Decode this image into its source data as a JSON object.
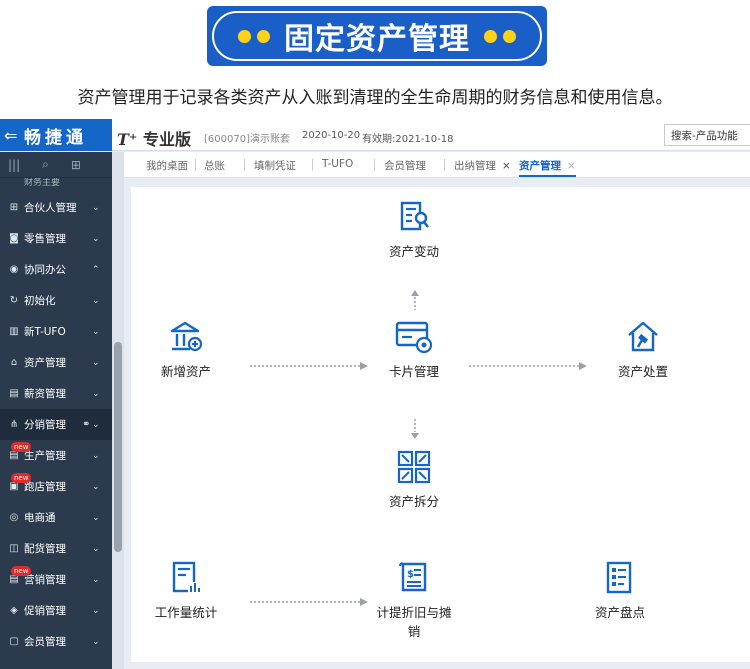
{
  "banner": {
    "title": "固定资产管理"
  },
  "subtitle": "资产管理用于记录各类资产从入账到清理的全生命周期的财务信息和使用信息。",
  "app": {
    "brand": "畅捷通",
    "product_mark": "T⁺",
    "product_name": "专业版",
    "account": "[600070]演示账套",
    "date": "2020-10-20",
    "valid": "有效期:2021-10-18",
    "search_placeholder": "搜索-产品功能"
  },
  "sidebar": {
    "partial_item": "财务主要",
    "items": [
      {
        "label": "合伙人管理",
        "icon": "partner-icon",
        "chevron": "⌄",
        "new": ""
      },
      {
        "label": "零售管理",
        "icon": "camera-icon",
        "chevron": "⌄",
        "new": ""
      },
      {
        "label": "协同办公",
        "icon": "collab-icon",
        "chevron": "⌃",
        "new": ""
      },
      {
        "label": "初始化",
        "icon": "init-icon",
        "chevron": "⌄",
        "new": ""
      },
      {
        "label": "新T-UFO",
        "icon": "ufo-icon",
        "chevron": "⌄",
        "new": ""
      },
      {
        "label": "资产管理",
        "icon": "bank-icon",
        "chevron": "⌄",
        "new": ""
      },
      {
        "label": "薪资管理",
        "icon": "salary-icon",
        "chevron": "⌄",
        "new": ""
      },
      {
        "label": "分销管理",
        "icon": "distribution-icon",
        "chevron": "⌄",
        "new": ""
      },
      {
        "label": "生产管理",
        "icon": "production-icon",
        "chevron": "⌄",
        "new": "new"
      },
      {
        "label": "跑店管理",
        "icon": "store-icon",
        "chevron": "⌄",
        "new": "new"
      },
      {
        "label": "电商通",
        "icon": "ecommerce-icon",
        "chevron": "⌄",
        "new": ""
      },
      {
        "label": "配货管理",
        "icon": "allocation-icon",
        "chevron": "⌄",
        "new": ""
      },
      {
        "label": "营销管理",
        "icon": "marketing-icon",
        "chevron": "⌄",
        "new": "new"
      },
      {
        "label": "促销管理",
        "icon": "promotion-icon",
        "chevron": "⌄",
        "new": ""
      },
      {
        "label": "会员管理",
        "icon": "member-icon",
        "chevron": "⌄",
        "new": ""
      }
    ]
  },
  "tabs": [
    {
      "label": "我的桌面"
    },
    {
      "label": "总账"
    },
    {
      "label": "填制凭证"
    },
    {
      "label": "T-UFO"
    },
    {
      "label": "会员管理"
    },
    {
      "label": "出纳管理",
      "close": "×"
    },
    {
      "label": "资产管理",
      "close": "×",
      "active": true
    }
  ],
  "flow": {
    "change": "资产变动",
    "add": "新增资产",
    "card": "卡片管理",
    "dispose": "资产处置",
    "split": "资产拆分",
    "workload": "工作量统计",
    "depreciation": "计提折旧与摊销",
    "inventory": "资产盘点"
  },
  "colors": {
    "accent": "#1466c9",
    "banner": "#1a5fc8",
    "sidebar": "#2b3a4c",
    "dot": "#ffd21a"
  }
}
